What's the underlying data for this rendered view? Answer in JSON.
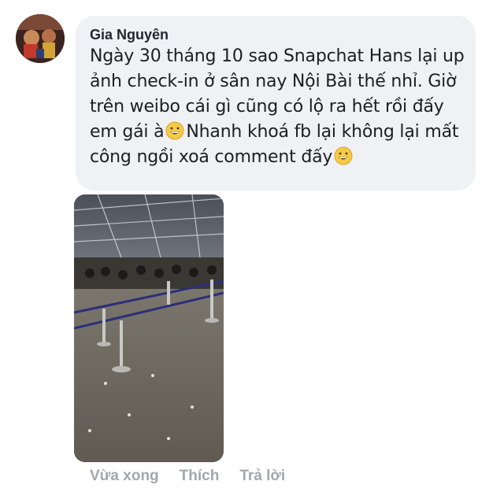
{
  "comment": {
    "author": "Gia Nguyên",
    "text_part1": "Ngày 30 tháng 10 sao Snapchat Hans lại up ảnh check-in ở sân nay Nội Bài thế nhỉ. Giờ trên weibo cái gì cũng có lộ ra hết rồi đấy em gái à",
    "text_part2": "Nhanh khoá fb lại không lại mất công ngồi xoá comment đấy",
    "emoji": "grinning-face-icon"
  },
  "actions": {
    "time": "Vừa xong",
    "like": "Thích",
    "reply": "Trả lời"
  }
}
